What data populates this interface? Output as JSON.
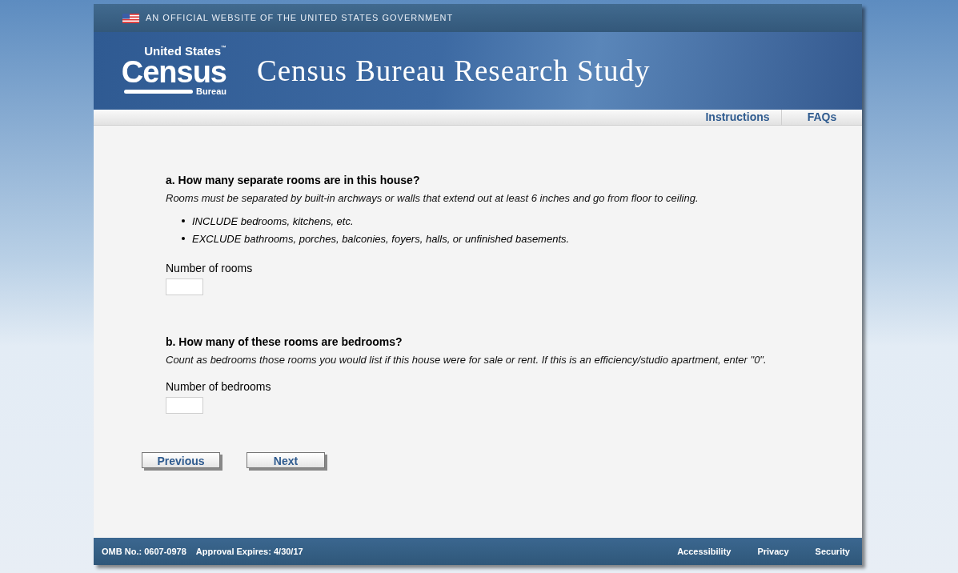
{
  "gov_banner": {
    "text": "AN OFFICIAL WEBSITE OF THE UNITED STATES GOVERNMENT"
  },
  "header": {
    "logo": {
      "top": "United States",
      "trademark": "™",
      "main": "Census",
      "bottom": "Bureau"
    },
    "title": "Census Bureau Research Study"
  },
  "nav": [
    "Instructions",
    "FAQs"
  ],
  "questions": [
    {
      "heading": "a. How many separate rooms are in this house?",
      "note": "Rooms must be separated by built-in archways or walls that extend out at least 6 inches and go from floor to ceiling.",
      "bullets": [
        "INCLUDE bedrooms, kitchens, etc.",
        "EXCLUDE bathrooms, porches, balconies, foyers, halls, or unfinished basements."
      ],
      "field_label": "Number of rooms"
    },
    {
      "heading": "b. How many of these rooms are bedrooms?",
      "note": "Count as bedrooms those rooms you would list if this house were for sale or rent. If this is an efficiency/studio apartment, enter \"0\".",
      "field_label": "Number of bedrooms"
    }
  ],
  "buttons": [
    "Previous",
    "Next"
  ],
  "footer": {
    "omb": "OMB No.: 0607-0978",
    "expires": "Approval Expires: 4/30/17",
    "links": [
      "Accessibility",
      "Privacy",
      "Security"
    ]
  }
}
